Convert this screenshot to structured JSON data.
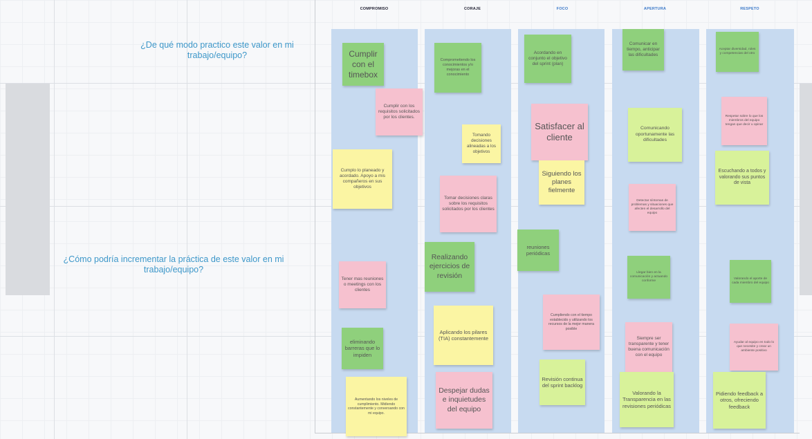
{
  "columns": [
    {
      "header": "COMPROMISO",
      "color": "#223"
    },
    {
      "header": "CORAJE",
      "color": "#223"
    },
    {
      "header": "FOCO",
      "color": "#3a78c8"
    },
    {
      "header": "APERTURA",
      "color": "#3a78c8"
    },
    {
      "header": "RESPETO",
      "color": "#3a78c8"
    }
  ],
  "questions": {
    "q1": "¿De qué modo practico este valor en mi trabajo/equipo?",
    "q2": "¿Cómo podría incrementar la práctica de este valor en mi trabajo/equipo?"
  },
  "notes": [
    {
      "text": "Cumplir con el timebox",
      "color": "green"
    },
    {
      "text": "Cumplir con los requisitos solicitados por los clientes.",
      "color": "pink"
    },
    {
      "text": "Cumplo lo planeado y acordado. Apoyo a mis compañeros en sus objetivos",
      "color": "yellow"
    },
    {
      "text": "Tener mas reuniones o meetings con los clientes",
      "color": "pink"
    },
    {
      "text": "eliminando barreras que lo impiden",
      "color": "green"
    },
    {
      "text": "Aumentando los niveles de cumplimiento. Midiendo constantemente y conversando con mi equipo.",
      "color": "yellow"
    },
    {
      "text": "Comprometiendo los conocimientos y/o mejoras en el conocimiento",
      "color": "green"
    },
    {
      "text": "Tomando decisiones alineadas a los objetivos",
      "color": "yellow"
    },
    {
      "text": "Tomar decisiones claras sobre los requisitos solicitados por los clientes",
      "color": "pink"
    },
    {
      "text": "Realizando ejercicios de revisión",
      "color": "green"
    },
    {
      "text": "Aplicando los pilares (TIA) constantemente",
      "color": "yellow"
    },
    {
      "text": "Despejar dudas e inquietudes del equipo",
      "color": "pink"
    },
    {
      "text": "Acordando en conjunto el objetivo del sprint (plan)",
      "color": "green"
    },
    {
      "text": "Satisfacer al cliente",
      "color": "pink"
    },
    {
      "text": "Siguiendo los planes fielmente",
      "color": "yellow"
    },
    {
      "text": "reuniones periódicas",
      "color": "green"
    },
    {
      "text": "Cumpliendo con el tiempo establecido y utilizando los recursos de la mejor manera posible",
      "color": "pink"
    },
    {
      "text": "Revisión continua del sprint backlog",
      "color": "lgreen"
    },
    {
      "text": "Comunicar en tiempo, anticipar las dificultades",
      "color": "green"
    },
    {
      "text": "Comunicando oportunamente las dificultades",
      "color": "lgreen"
    },
    {
      "text": "Detectar síntomas de problemas y situaciones que afecten el desarrollo del equipo",
      "color": "pink"
    },
    {
      "text": "Llegar bien en la comunicación y actuando conforme",
      "color": "green"
    },
    {
      "text": "Siempre ser transparente y tener buena comunicación con el equipo",
      "color": "pink"
    },
    {
      "text": "Valorando la Transparencia en las revisiones periódicas",
      "color": "lgreen"
    },
    {
      "text": "Aceptar diversidad, roles y competencias del otro",
      "color": "green"
    },
    {
      "text": "Respetar sobre lo que los miembros del equipo tengan que decir u opinar",
      "color": "pink"
    },
    {
      "text": "Escuchando a todos y valorando sus puntos de vista",
      "color": "lgreen"
    },
    {
      "text": "Valorando el aporte de cada miembro del equipo",
      "color": "green"
    },
    {
      "text": "Ayudar al equipo en todo lo que necesite y crear un ambiente positivo",
      "color": "pink"
    },
    {
      "text": "Pidiendo feedback a otros, ofreciendo feedback",
      "color": "lgreen"
    }
  ]
}
